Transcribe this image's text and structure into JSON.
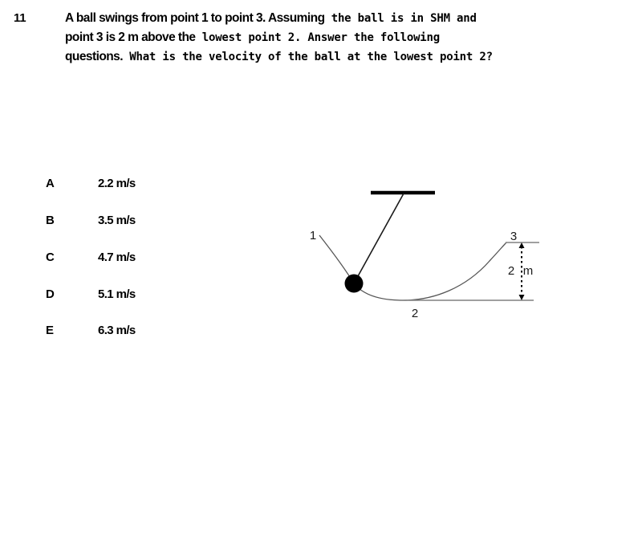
{
  "question": {
    "number": "11",
    "lines": [
      [
        {
          "style": "sans",
          "text": "A ball swings from point 1 to point 3. Assuming"
        },
        {
          "style": "mono",
          "text": "  the ball is in SHM and"
        }
      ],
      [
        {
          "style": "sans",
          "text": "point 3 is 2 m above the"
        },
        {
          "style": "mono",
          "text": "  lowest point 2. Answer the following"
        }
      ],
      [
        {
          "style": "sans",
          "text": "questions."
        },
        {
          "style": "mono",
          "text": "  What is the velocity of the ball at the lowest point  2?"
        }
      ]
    ]
  },
  "options": [
    {
      "letter": "A",
      "value": "2.2 m/s"
    },
    {
      "letter": "B",
      "value": "3.5 m/s"
    },
    {
      "letter": "C",
      "value": "4.7 m/s"
    },
    {
      "letter": "D",
      "value": "5.1 m/s"
    },
    {
      "letter": "E",
      "value": "6.3 m/s"
    }
  ],
  "diagram": {
    "labels": {
      "point1": "1",
      "point2": "2",
      "point3": "3",
      "height": "2",
      "height_unit": "m"
    },
    "colors": {
      "ink": "#000000",
      "line": "#808080",
      "curve": "#555555"
    }
  }
}
